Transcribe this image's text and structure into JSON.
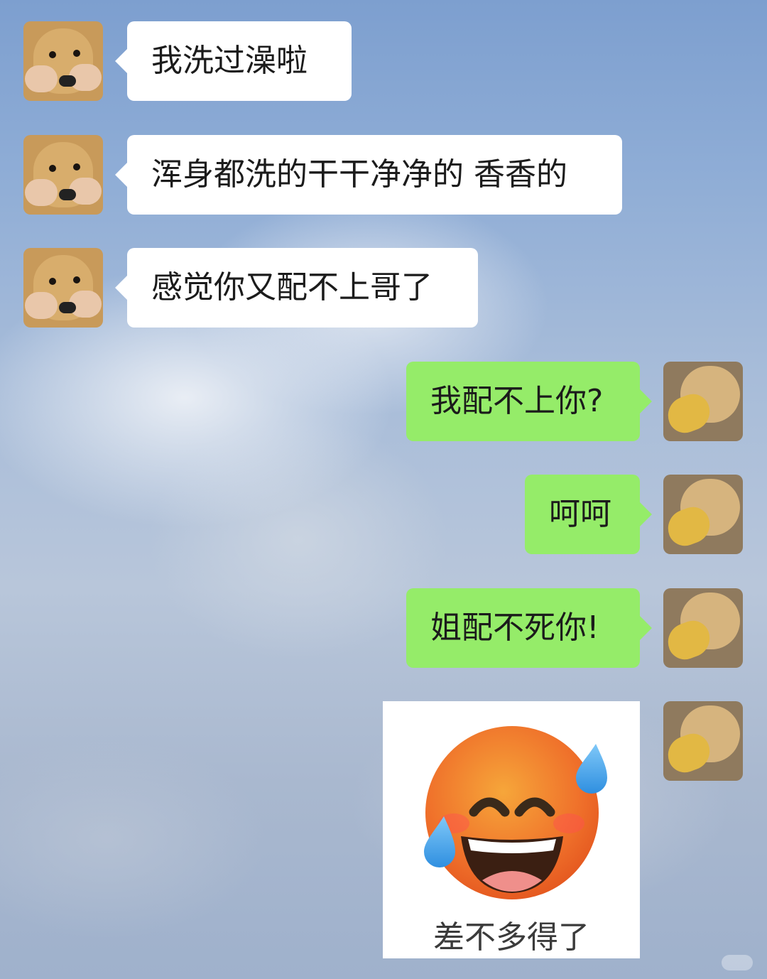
{
  "chat": {
    "messages": [
      {
        "side": "left",
        "text": "我洗过澡啦"
      },
      {
        "side": "left",
        "text": "浑身都洗的干干净净的 香香的"
      },
      {
        "side": "left",
        "text": "感觉你又配不上哥了"
      },
      {
        "side": "right",
        "text": "我配不上你?"
      },
      {
        "side": "right",
        "text": "呵呵"
      },
      {
        "side": "right",
        "text": "姐配不死你!"
      }
    ],
    "sticker": {
      "caption": "差不多得了",
      "icon": "grinning-sweat-emoji-icon"
    }
  },
  "colors": {
    "left_bubble": "#ffffff",
    "right_bubble": "#95ec69"
  }
}
